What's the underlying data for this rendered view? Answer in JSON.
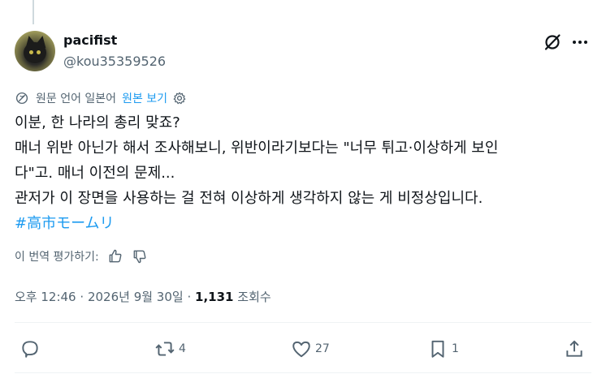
{
  "author": {
    "display_name": "pacifist",
    "handle": "@kou35359526",
    "avatar_icon": "black-cat-avatar"
  },
  "header_icons": {
    "grok": "grok-icon",
    "more": "more-dots-icon"
  },
  "translation": {
    "label": "원문 언어 일본어",
    "show_original": "원본 보기"
  },
  "tweet": {
    "lines": [
      "이분, 한 나라의 총리 맞죠?",
      "매너 위반 아닌가 해서 조사해보니, 위반이라기보다는 \"너무 튀고·이상하게 보인",
      "다\"고. 매너 이전의 문제...",
      "관저가 이 장면을 사용하는 걸 전혀 이상하게 생각하지 않는 게 비정상입니다."
    ],
    "hashtag": "#高市モームリ"
  },
  "rate_translation": {
    "label": "이 번역 평가하기:"
  },
  "meta": {
    "time": "오후 12:46",
    "separator": "·",
    "date": "2026년 9월 30일",
    "views_count": "1,131",
    "views_label": "조회수"
  },
  "actions": {
    "reply_count": "",
    "retweet_count": "4",
    "like_count": "27",
    "bookmark_count": "1"
  },
  "colors": {
    "accent": "#1d9bf0",
    "secondary_text": "#536471",
    "primary_text": "#0f1419",
    "divider": "#eff3f4"
  }
}
